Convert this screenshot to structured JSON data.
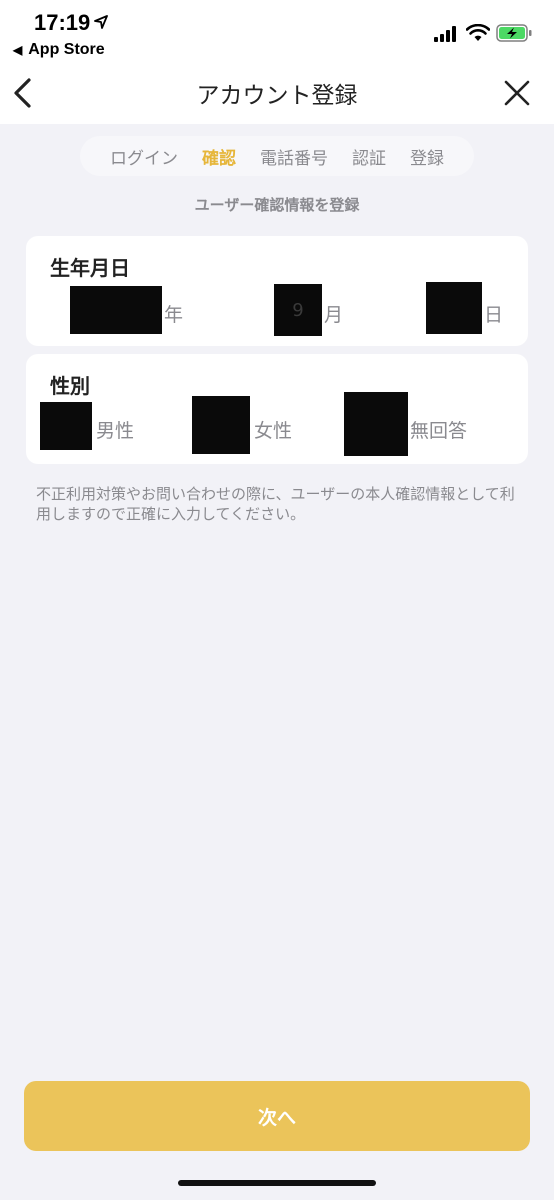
{
  "status_bar": {
    "time": "17:19",
    "back_app_label": "App Store",
    "back_app_glyph": "◀"
  },
  "nav": {
    "title": "アカウント登録",
    "back_icon": "chevron-left-icon",
    "close_icon": "close-icon"
  },
  "steps": [
    {
      "label": "ログイン",
      "active": false
    },
    {
      "label": "確認",
      "active": true
    },
    {
      "label": "電話番号",
      "active": false
    },
    {
      "label": "認証",
      "active": false
    },
    {
      "label": "登録",
      "active": false
    }
  ],
  "subtitle": "ユーザー確認情報を登録",
  "birthdate": {
    "title": "生年月日",
    "year_unit": "年",
    "month_value": "9",
    "month_unit": "月",
    "day_unit": "日"
  },
  "gender": {
    "title": "性別",
    "options": [
      {
        "label": "男性"
      },
      {
        "label": "女性"
      },
      {
        "label": "無回答"
      }
    ]
  },
  "note": "不正利用対策やお問い合わせの際に、ユーザーの本人確認情報として利用しますので正確に入力してください。",
  "next_button": "次へ",
  "colors": {
    "accent": "#e6b63a",
    "button": "#ebc45a",
    "background": "#f2f2f7",
    "muted_text": "#8a8a8f"
  }
}
